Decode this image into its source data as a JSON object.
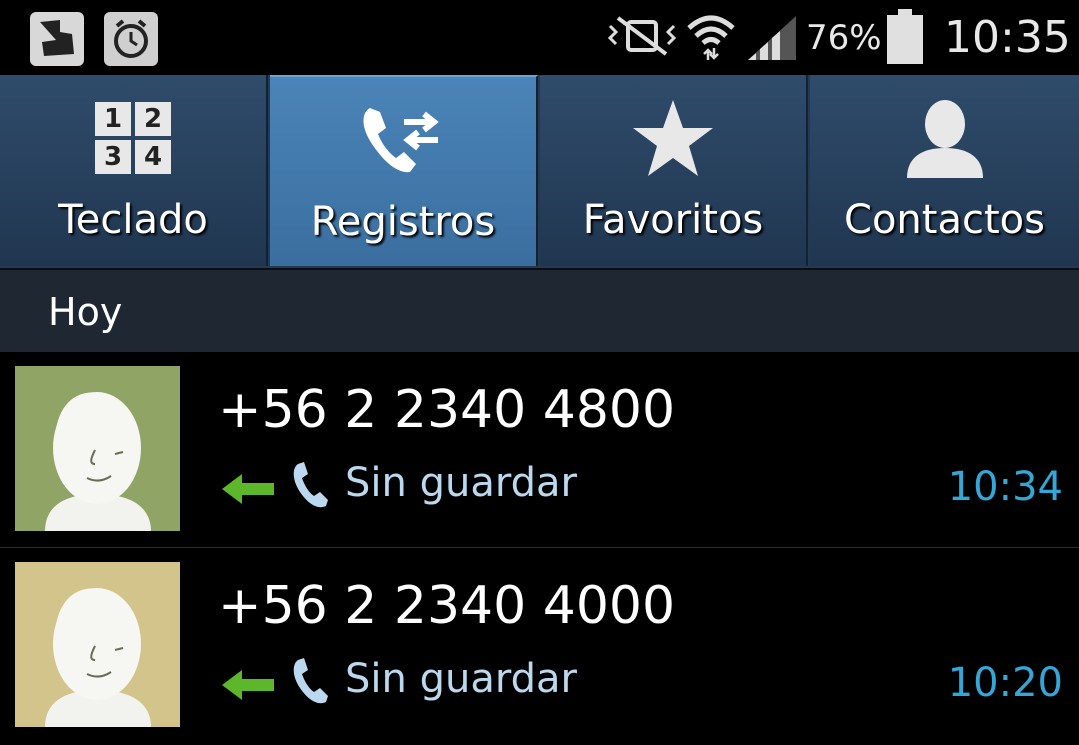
{
  "statusbar": {
    "battery_percent": "76%",
    "clock": "10:35",
    "icons": [
      "app-notification-icon",
      "alarm-icon",
      "vibrate-mute-icon",
      "wifi-icon",
      "signal-icon",
      "battery-icon"
    ]
  },
  "tabs": [
    {
      "label": "Teclado",
      "icon": "keypad-icon",
      "active": false
    },
    {
      "label": "Registros",
      "icon": "call-log-icon",
      "active": true
    },
    {
      "label": "Favoritos",
      "icon": "star-icon",
      "active": false
    },
    {
      "label": "Contactos",
      "icon": "contact-icon",
      "active": false
    }
  ],
  "keypad": [
    "1",
    "2",
    "3",
    "4"
  ],
  "section": {
    "title": "Hoy"
  },
  "calls": [
    {
      "number": "+56 2 2340 4800",
      "status": "Sin guardar",
      "time": "10:34",
      "avatar_color": "#8fa465"
    },
    {
      "number": "+56 2 2340 4000",
      "status": "Sin guardar",
      "time": "10:20",
      "avatar_color": "#d3c48b"
    }
  ],
  "colors": {
    "accent_time": "#34a7d6",
    "incoming_arrow": "#5cb82a",
    "active_tab": "#4b84b8"
  }
}
